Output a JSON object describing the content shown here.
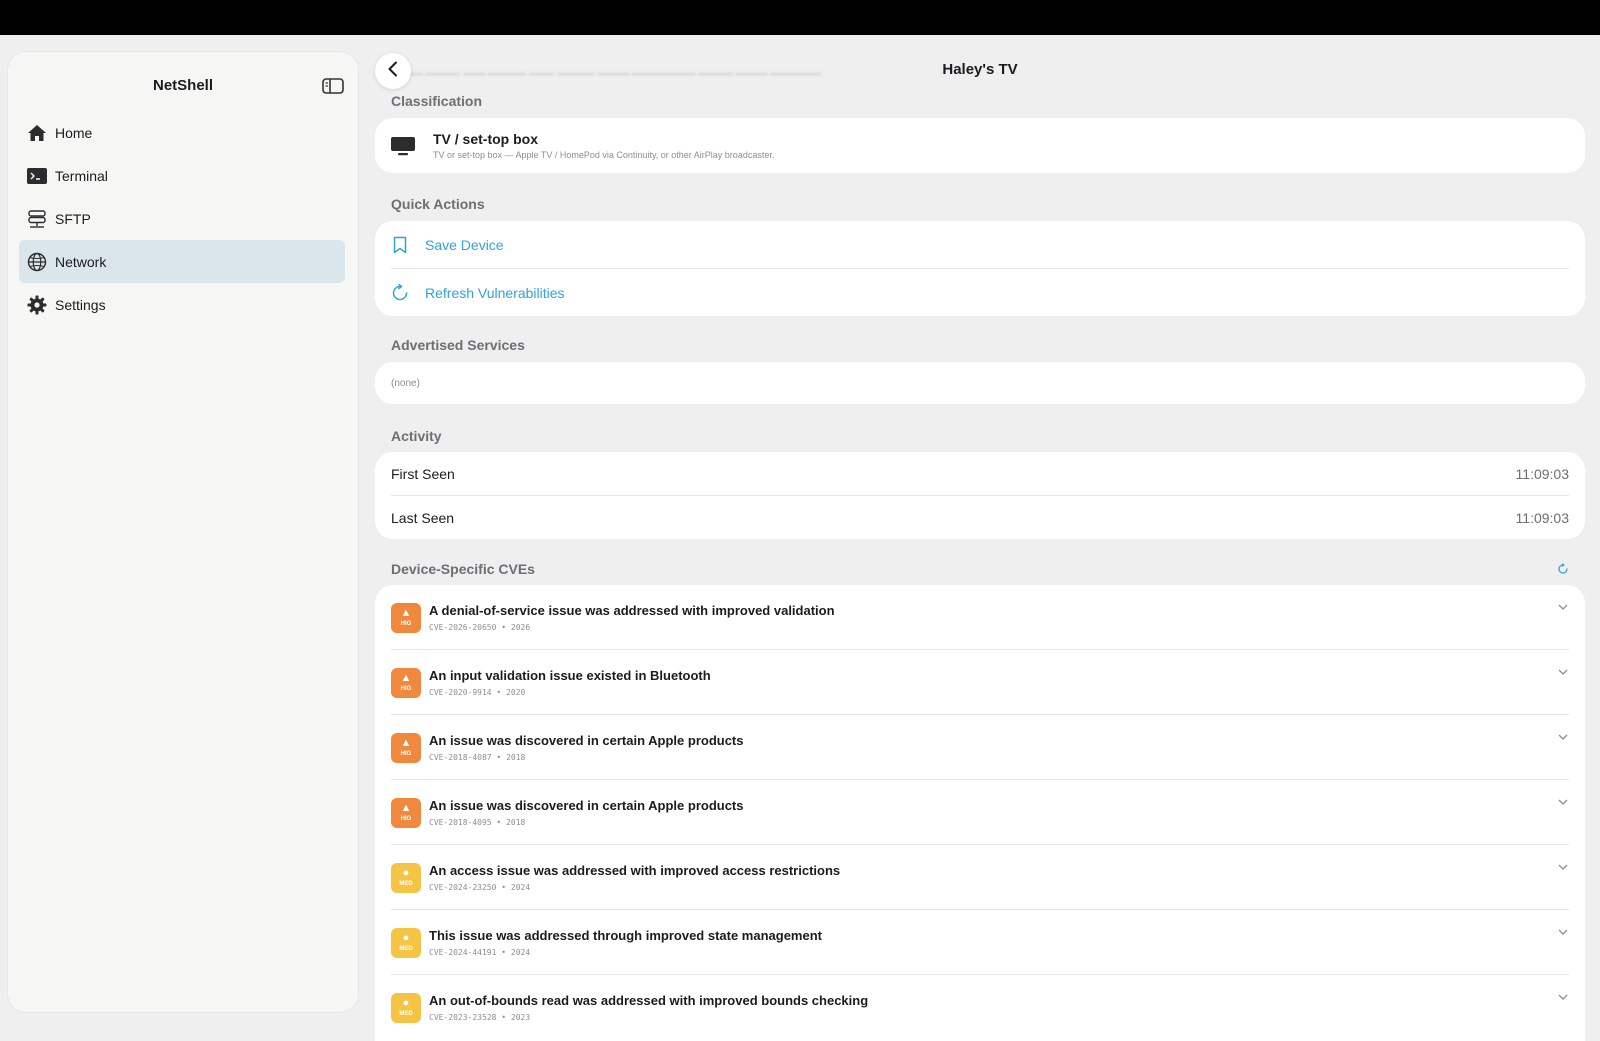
{
  "sidebar": {
    "title": "NetShell",
    "items": [
      {
        "label": "Home",
        "icon": "house-icon"
      },
      {
        "label": "Terminal",
        "icon": "terminal-icon"
      },
      {
        "label": "SFTP",
        "icon": "server-icon"
      },
      {
        "label": "Network",
        "icon": "globe-icon",
        "active": true
      },
      {
        "label": "Settings",
        "icon": "gear-icon"
      }
    ]
  },
  "header": {
    "title": "Haley's TV"
  },
  "classification": {
    "label": "Classification",
    "title": "TV / set-top box",
    "subtitle": "TV or set-top box — Apple TV / HomePod via Continuity, or other AirPlay broadcaster."
  },
  "quick_actions": {
    "label": "Quick Actions",
    "save": "Save Device",
    "refresh": "Refresh Vulnerabilities"
  },
  "services": {
    "label": "Advertised Services",
    "value": "(none)"
  },
  "activity": {
    "label": "Activity",
    "rows": [
      {
        "label": "First Seen",
        "value": "11:09:03"
      },
      {
        "label": "Last Seen",
        "value": "11:09:03"
      }
    ]
  },
  "cves": {
    "label": "Device-Specific CVEs",
    "items": [
      {
        "title": "A denial-of-service issue was addressed with improved validation",
        "meta": "CVE-2026-20650 • 2026",
        "severity": "HIG",
        "glyph": "▲"
      },
      {
        "title": "An input validation issue existed in Bluetooth",
        "meta": "CVE-2020-9914 • 2020",
        "severity": "HIG",
        "glyph": "▲"
      },
      {
        "title": "An issue was discovered in certain Apple products",
        "meta": "CVE-2018-4087 • 2018",
        "severity": "HIG",
        "glyph": "▲"
      },
      {
        "title": "An issue was discovered in certain Apple products",
        "meta": "CVE-2018-4095 • 2018",
        "severity": "HIG",
        "glyph": "▲"
      },
      {
        "title": "An access issue was addressed with improved access restrictions",
        "meta": "CVE-2024-23250 • 2024",
        "severity": "MED",
        "glyph": "●"
      },
      {
        "title": "This issue was addressed through improved state management",
        "meta": "CVE-2024-44191 • 2024",
        "severity": "MED",
        "glyph": "●"
      },
      {
        "title": "An out-of-bounds read was addressed with improved bounds checking",
        "meta": "CVE-2023-23528 • 2023",
        "severity": "MED",
        "glyph": "●"
      }
    ]
  },
  "colors": {
    "accent": "#32a3d8",
    "high": "#f0883e",
    "medium": "#f6c444",
    "active_nav": "#dbe6ec"
  }
}
